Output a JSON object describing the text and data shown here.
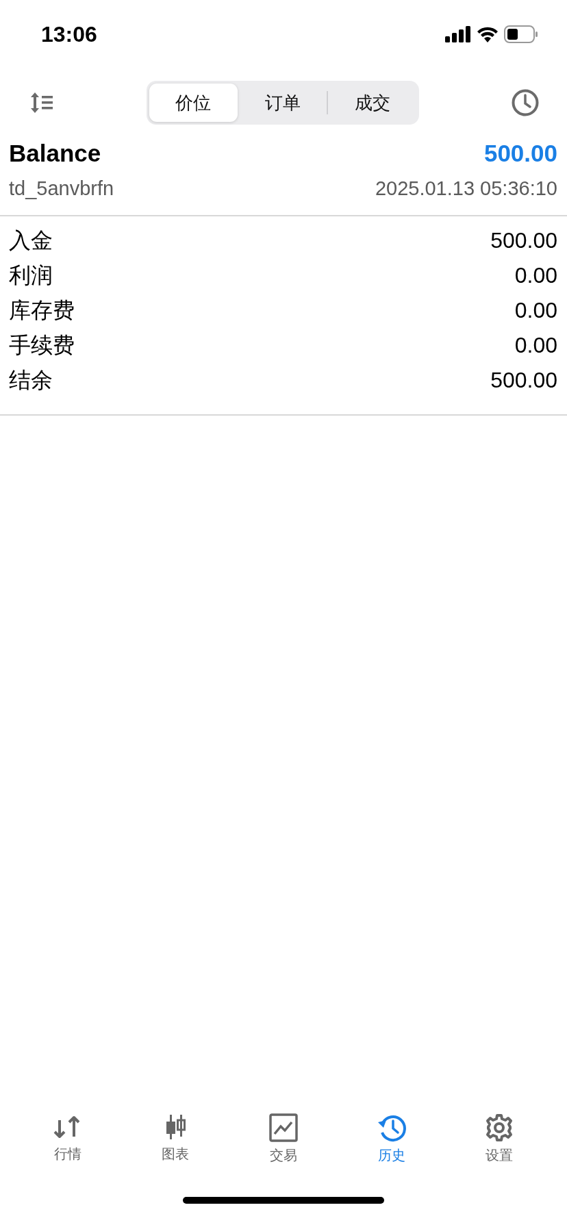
{
  "status_bar": {
    "time": "13:06"
  },
  "segments": [
    {
      "label": "价位",
      "selected": true
    },
    {
      "label": "订单",
      "selected": false
    },
    {
      "label": "成交",
      "selected": false
    }
  ],
  "summary": {
    "title": "Balance",
    "value": "500.00",
    "account": "td_5anvbrfn",
    "datetime": "2025.01.13 05:36:10"
  },
  "rows": [
    {
      "label": "入金",
      "value": "500.00"
    },
    {
      "label": "利润",
      "value": "0.00"
    },
    {
      "label": "库存费",
      "value": "0.00"
    },
    {
      "label": "手续费",
      "value": "0.00"
    },
    {
      "label": "结余",
      "value": "500.00"
    }
  ],
  "tab_bar": [
    {
      "kind": "quotes",
      "label": "行情",
      "selected": false
    },
    {
      "kind": "chart",
      "label": "图表",
      "selected": false
    },
    {
      "kind": "trade",
      "label": "交易",
      "selected": false
    },
    {
      "kind": "history",
      "label": "历史",
      "selected": true
    },
    {
      "kind": "settings",
      "label": "设置",
      "selected": false
    }
  ]
}
